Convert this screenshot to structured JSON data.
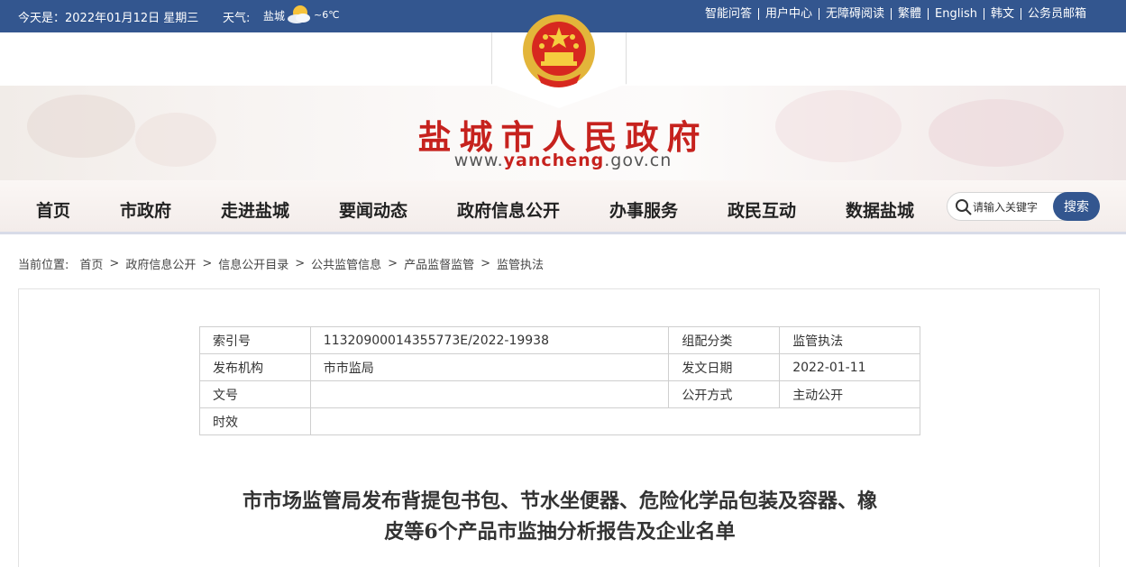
{
  "topbar": {
    "date": "今天是：2022年01月12日 星期三",
    "weather_label": "天气:",
    "weather_city": "盐城",
    "weather_temp": "~6℃",
    "links": [
      "智能问答",
      "用户中心",
      "无障碍阅读",
      "繁體",
      "English",
      "韩文",
      "公务员邮箱"
    ]
  },
  "header": {
    "site_title": "盐城市人民政府",
    "url_prefix": "www.",
    "url_highlight": "yancheng",
    "url_suffix": ".gov.cn"
  },
  "nav": {
    "items": [
      "首页",
      "市政府",
      "走进盐城",
      "要闻动态",
      "政府信息公开",
      "办事服务",
      "政民互动",
      "数据盐城"
    ],
    "search_placeholder": "请输入关键字",
    "search_button": "搜索"
  },
  "breadcrumb": {
    "lead": "当前位置:",
    "items": [
      "首页",
      "政府信息公开",
      "信息公开目录",
      "公共监管信息",
      "产品监督监管",
      "监管执法"
    ]
  },
  "meta": {
    "rows": [
      [
        "索引号",
        "11320900014355773E/2022-19938",
        "组配分类",
        "监管执法"
      ],
      [
        "发布机构",
        "市市监局",
        "发文日期",
        "2022-01-11"
      ],
      [
        "文号",
        "",
        "公开方式",
        "主动公开"
      ],
      [
        "时效",
        ""
      ]
    ]
  },
  "article": {
    "title_line1": "市市场监管局发布背提包书包、节水坐便器、危险化学品包装及容器、橡",
    "title_line2": "皮等6个产品市监抽分析报告及企业名单"
  },
  "colors": {
    "topbar": "#33568f",
    "title_red": "#c6221e",
    "search_button": "#33568f"
  }
}
